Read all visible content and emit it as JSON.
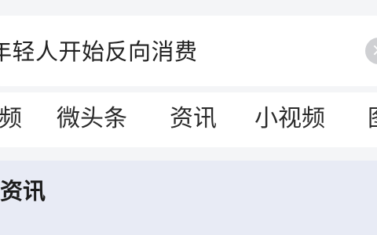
{
  "search": {
    "query": "年轻人开始反向消费",
    "clear_icon": "×"
  },
  "tabs": [
    {
      "label": "频"
    },
    {
      "label": "微头条"
    },
    {
      "label": "资讯"
    },
    {
      "label": "小视频"
    },
    {
      "label": "图"
    }
  ],
  "section": {
    "title": "资讯"
  }
}
